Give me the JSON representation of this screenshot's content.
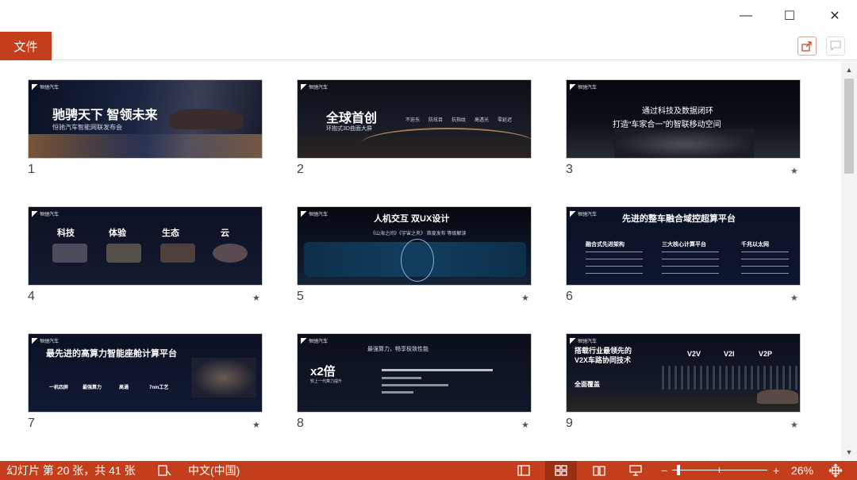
{
  "window": {
    "minimize_glyph": "—",
    "maximize_glyph": "☐",
    "close_glyph": "✕"
  },
  "ribbon": {
    "file_label": "文件",
    "share_icon": "share-icon",
    "comment_icon": "comment-icon"
  },
  "colors": {
    "accent": "#c43e1c",
    "accent_dark": "#9b2f12",
    "slide_bg": "#0d1220"
  },
  "slides": [
    {
      "number": "1",
      "texts": [
        "驰骋天下 智领未来",
        "恒驰汽车智能网联发布会"
      ]
    },
    {
      "number": "2",
      "texts": [
        "全球首创",
        "环抱式3D曲面大屏",
        "不迫东",
        "防炫目",
        "抗指纹",
        "高透光",
        "零延迟"
      ]
    },
    {
      "number": "3",
      "texts": [
        "通过科技及数据闭环",
        "打造“车家合一”的智联移动空间"
      ]
    },
    {
      "number": "4",
      "texts": [
        "科技",
        "体验",
        "生态",
        "云"
      ]
    },
    {
      "number": "5",
      "texts": [
        "人机交互 双UX设计",
        "《山海之间》《宇宙之央》 首度发布 等级解读"
      ]
    },
    {
      "number": "6",
      "texts": [
        "先进的整车融合域控超算平台",
        "融合式先进架构",
        "三大核心计算平台",
        "千兆以太网"
      ]
    },
    {
      "number": "7",
      "texts": [
        "最先进的高算力智能座舱计算平台",
        "一机四屏",
        "最强算力",
        "高通",
        "7nm工艺"
      ]
    },
    {
      "number": "8",
      "texts": [
        "最强算力，畅享极致性能",
        "x2倍",
        "较上一代算力提升"
      ]
    },
    {
      "number": "9",
      "texts": [
        "搭载行业最领先的",
        "V2X车路协同技术",
        "全面覆盖",
        "V2V",
        "V2I",
        "V2P"
      ]
    }
  ],
  "status": {
    "slide_info": "幻灯片 第 20 张，共 41 张",
    "language": "中文(中国)",
    "zoom_minus": "−",
    "zoom_plus": "+",
    "zoom_level": "26%"
  },
  "star_glyph": "★"
}
